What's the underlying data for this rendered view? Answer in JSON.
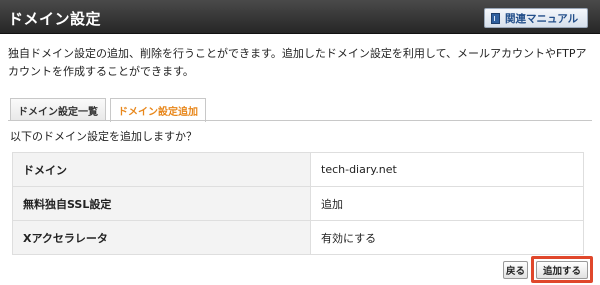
{
  "header": {
    "title": "ドメイン設定",
    "manual_button_label": "関連マニュアル"
  },
  "description": "独自ドメイン設定の追加、削除を行うことができます。追加したドメイン設定を利用して、メールアカウントやFTPアカウントを作成することができます。",
  "tabs": [
    {
      "label": "ドメイン設定一覧",
      "active": false
    },
    {
      "label": "ドメイン設定追加",
      "active": true
    }
  ],
  "confirm_text": "以下のドメイン設定を追加しますか？",
  "settings": [
    {
      "key": "ドメイン",
      "value": "tech-diary.net"
    },
    {
      "key": "無料独自SSL設定",
      "value": "追加"
    },
    {
      "key": "Xアクセラレータ",
      "value": "有効にする"
    }
  ],
  "actions": {
    "back_label": "戻る",
    "add_label": "追加する"
  },
  "colors": {
    "active_tab": "#e8871b",
    "highlight": "#e0472b",
    "header_bg": "#262626"
  }
}
